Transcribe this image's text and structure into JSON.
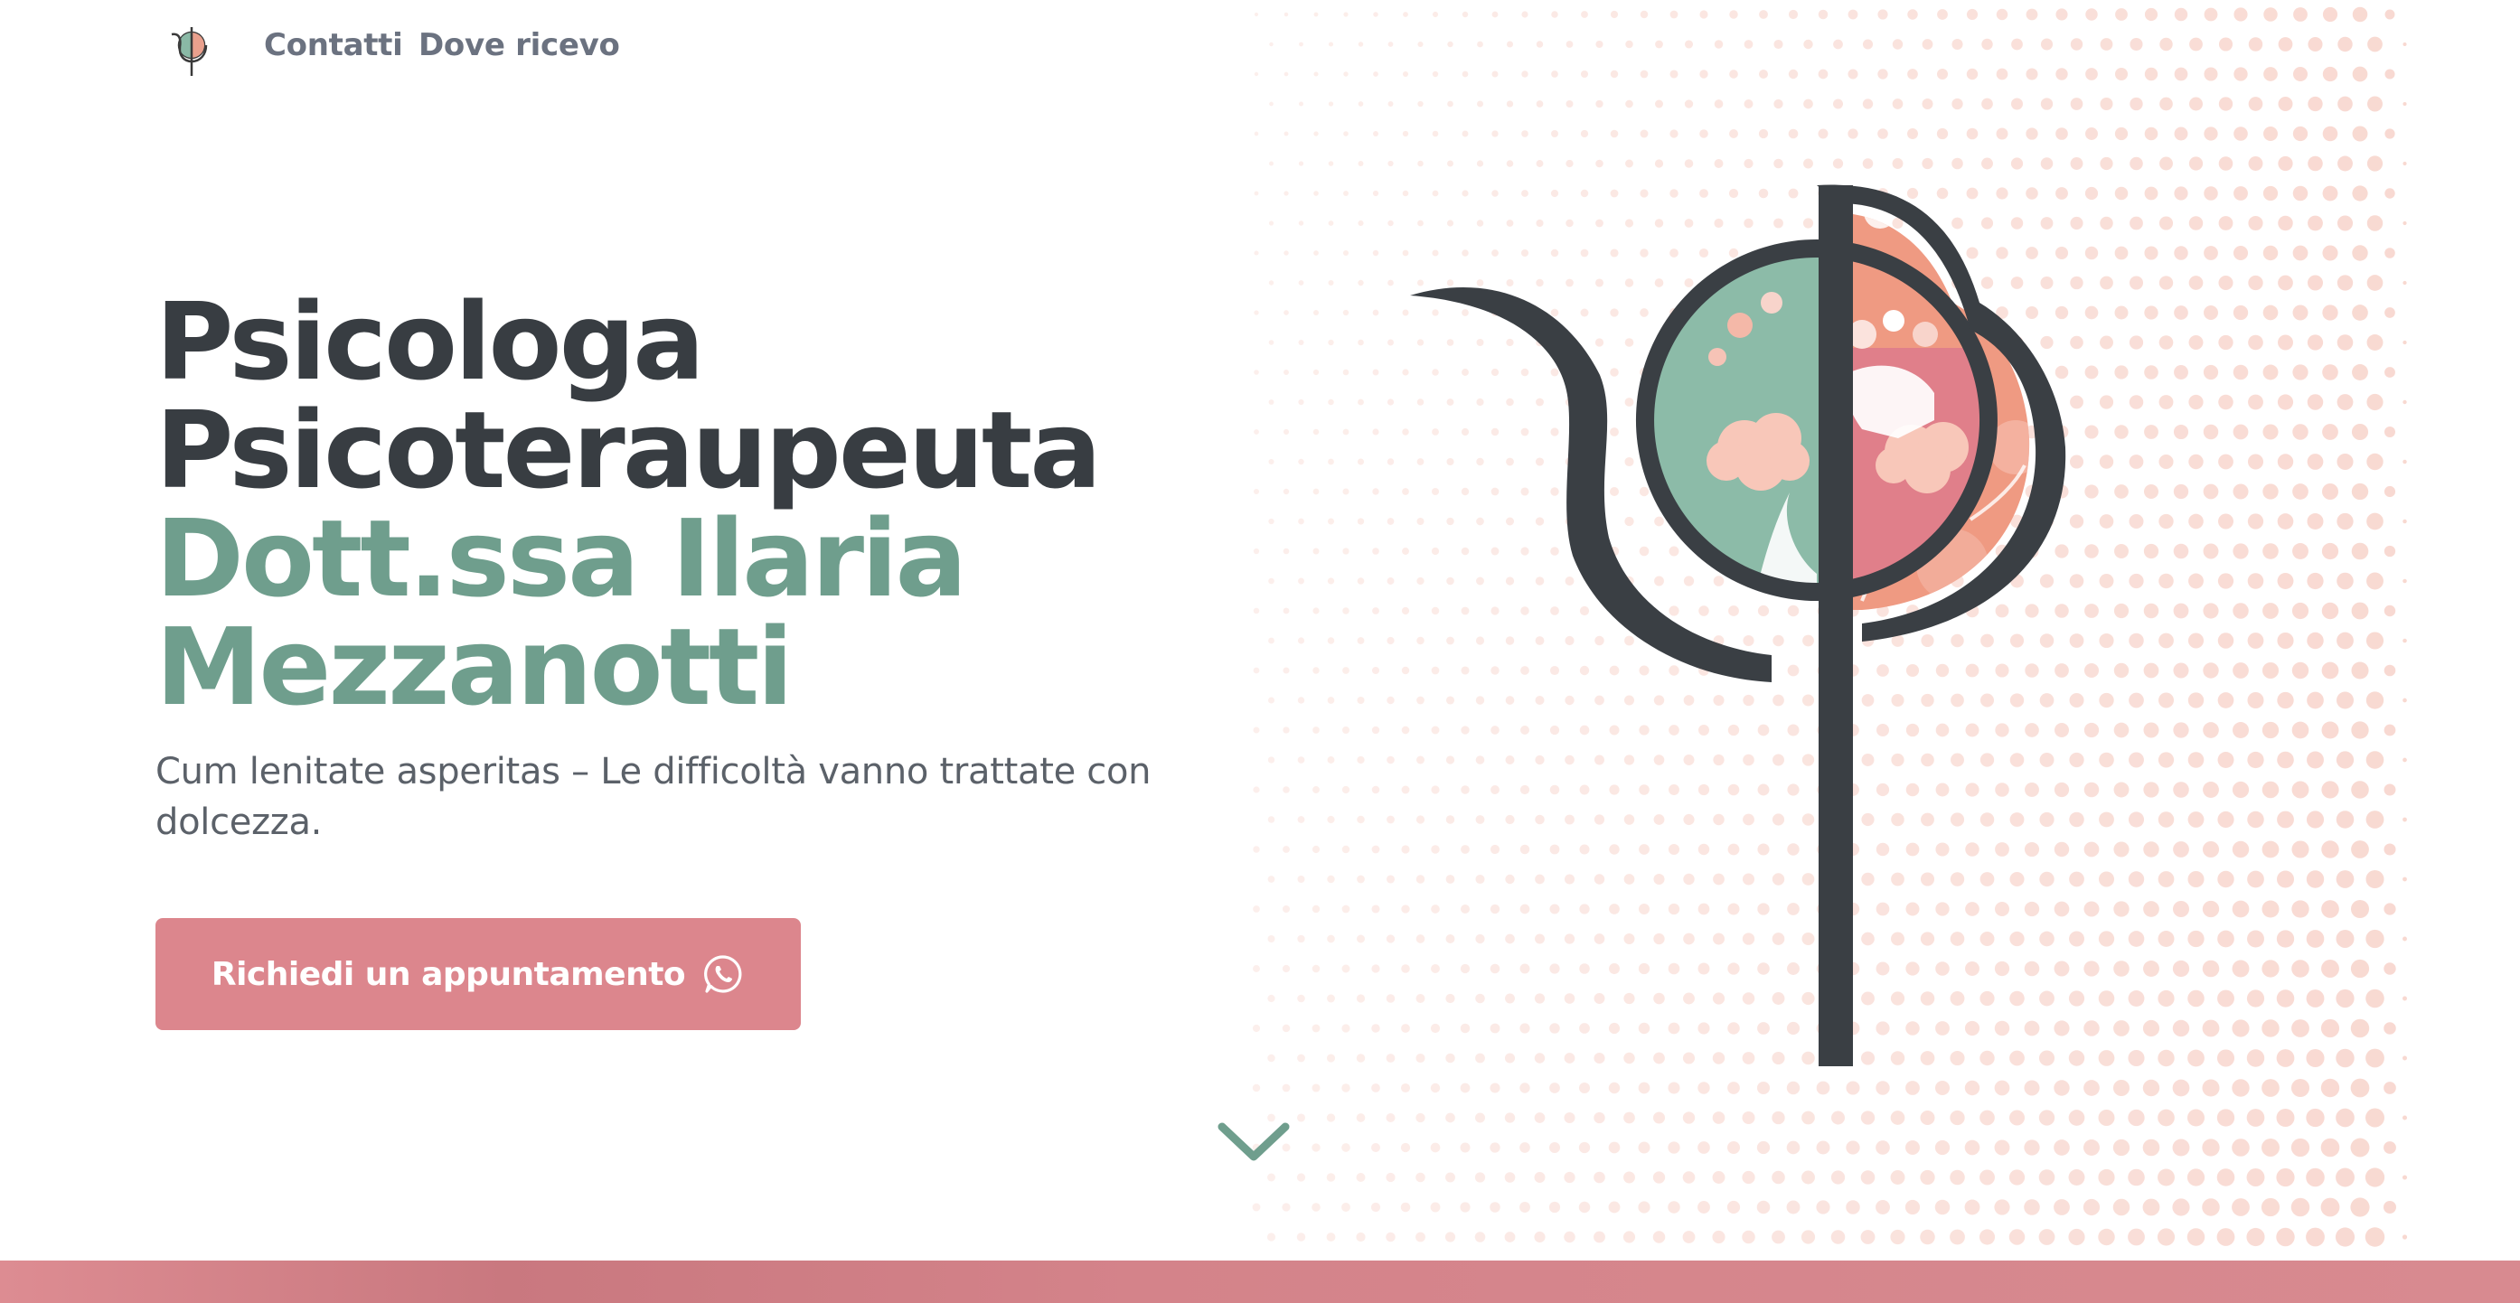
{
  "nav": {
    "logo_icon": "psi-logo-icon",
    "links": [
      {
        "label": "Contatti"
      },
      {
        "label": "Dove ricevo"
      }
    ]
  },
  "hero": {
    "title_line1": "Psicologa",
    "title_line2": "Psicoteraupeuta",
    "name_line1": "Dott.ssa Ilaria",
    "name_line2": "Mezzanotti",
    "subtitle": "Cum lenitate asperitas – Le difficoltà vanno trattate con dolcezza.",
    "cta_label": "Richiedi un appuntamento",
    "cta_icon": "whatsapp-icon",
    "illustration_icon": "psi-emblem-illustration",
    "scroll_icon": "chevron-down-icon"
  },
  "colors": {
    "dark_text": "#383d42",
    "accent_green": "#6f9e8d",
    "accent_pink": "#dc868d",
    "peach": "#ef9a82",
    "dot_color": "#f7d2c9",
    "muted_text": "#5b6169"
  }
}
